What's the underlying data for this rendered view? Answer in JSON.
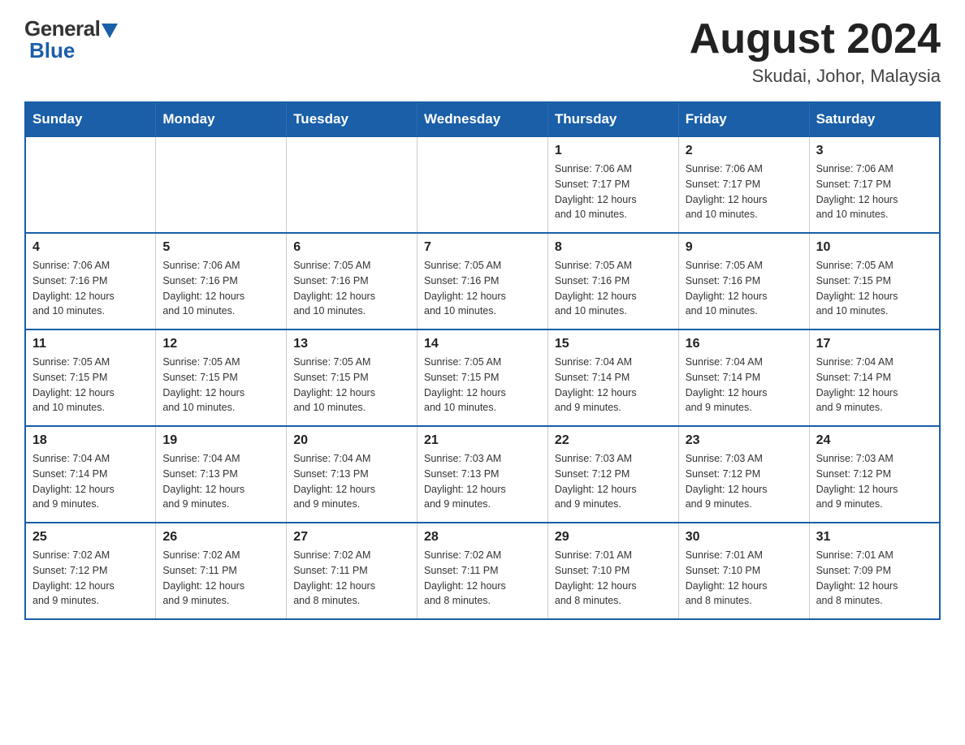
{
  "logo": {
    "general_text": "General",
    "blue_text": "Blue",
    "tagline": "Blue"
  },
  "header": {
    "month_year": "August 2024",
    "location": "Skudai, Johor, Malaysia"
  },
  "days_of_week": [
    "Sunday",
    "Monday",
    "Tuesday",
    "Wednesday",
    "Thursday",
    "Friday",
    "Saturday"
  ],
  "weeks": [
    [
      {
        "day": "",
        "info": ""
      },
      {
        "day": "",
        "info": ""
      },
      {
        "day": "",
        "info": ""
      },
      {
        "day": "",
        "info": ""
      },
      {
        "day": "1",
        "info": "Sunrise: 7:06 AM\nSunset: 7:17 PM\nDaylight: 12 hours\nand 10 minutes."
      },
      {
        "day": "2",
        "info": "Sunrise: 7:06 AM\nSunset: 7:17 PM\nDaylight: 12 hours\nand 10 minutes."
      },
      {
        "day": "3",
        "info": "Sunrise: 7:06 AM\nSunset: 7:17 PM\nDaylight: 12 hours\nand 10 minutes."
      }
    ],
    [
      {
        "day": "4",
        "info": "Sunrise: 7:06 AM\nSunset: 7:16 PM\nDaylight: 12 hours\nand 10 minutes."
      },
      {
        "day": "5",
        "info": "Sunrise: 7:06 AM\nSunset: 7:16 PM\nDaylight: 12 hours\nand 10 minutes."
      },
      {
        "day": "6",
        "info": "Sunrise: 7:05 AM\nSunset: 7:16 PM\nDaylight: 12 hours\nand 10 minutes."
      },
      {
        "day": "7",
        "info": "Sunrise: 7:05 AM\nSunset: 7:16 PM\nDaylight: 12 hours\nand 10 minutes."
      },
      {
        "day": "8",
        "info": "Sunrise: 7:05 AM\nSunset: 7:16 PM\nDaylight: 12 hours\nand 10 minutes."
      },
      {
        "day": "9",
        "info": "Sunrise: 7:05 AM\nSunset: 7:16 PM\nDaylight: 12 hours\nand 10 minutes."
      },
      {
        "day": "10",
        "info": "Sunrise: 7:05 AM\nSunset: 7:15 PM\nDaylight: 12 hours\nand 10 minutes."
      }
    ],
    [
      {
        "day": "11",
        "info": "Sunrise: 7:05 AM\nSunset: 7:15 PM\nDaylight: 12 hours\nand 10 minutes."
      },
      {
        "day": "12",
        "info": "Sunrise: 7:05 AM\nSunset: 7:15 PM\nDaylight: 12 hours\nand 10 minutes."
      },
      {
        "day": "13",
        "info": "Sunrise: 7:05 AM\nSunset: 7:15 PM\nDaylight: 12 hours\nand 10 minutes."
      },
      {
        "day": "14",
        "info": "Sunrise: 7:05 AM\nSunset: 7:15 PM\nDaylight: 12 hours\nand 10 minutes."
      },
      {
        "day": "15",
        "info": "Sunrise: 7:04 AM\nSunset: 7:14 PM\nDaylight: 12 hours\nand 9 minutes."
      },
      {
        "day": "16",
        "info": "Sunrise: 7:04 AM\nSunset: 7:14 PM\nDaylight: 12 hours\nand 9 minutes."
      },
      {
        "day": "17",
        "info": "Sunrise: 7:04 AM\nSunset: 7:14 PM\nDaylight: 12 hours\nand 9 minutes."
      }
    ],
    [
      {
        "day": "18",
        "info": "Sunrise: 7:04 AM\nSunset: 7:14 PM\nDaylight: 12 hours\nand 9 minutes."
      },
      {
        "day": "19",
        "info": "Sunrise: 7:04 AM\nSunset: 7:13 PM\nDaylight: 12 hours\nand 9 minutes."
      },
      {
        "day": "20",
        "info": "Sunrise: 7:04 AM\nSunset: 7:13 PM\nDaylight: 12 hours\nand 9 minutes."
      },
      {
        "day": "21",
        "info": "Sunrise: 7:03 AM\nSunset: 7:13 PM\nDaylight: 12 hours\nand 9 minutes."
      },
      {
        "day": "22",
        "info": "Sunrise: 7:03 AM\nSunset: 7:12 PM\nDaylight: 12 hours\nand 9 minutes."
      },
      {
        "day": "23",
        "info": "Sunrise: 7:03 AM\nSunset: 7:12 PM\nDaylight: 12 hours\nand 9 minutes."
      },
      {
        "day": "24",
        "info": "Sunrise: 7:03 AM\nSunset: 7:12 PM\nDaylight: 12 hours\nand 9 minutes."
      }
    ],
    [
      {
        "day": "25",
        "info": "Sunrise: 7:02 AM\nSunset: 7:12 PM\nDaylight: 12 hours\nand 9 minutes."
      },
      {
        "day": "26",
        "info": "Sunrise: 7:02 AM\nSunset: 7:11 PM\nDaylight: 12 hours\nand 9 minutes."
      },
      {
        "day": "27",
        "info": "Sunrise: 7:02 AM\nSunset: 7:11 PM\nDaylight: 12 hours\nand 8 minutes."
      },
      {
        "day": "28",
        "info": "Sunrise: 7:02 AM\nSunset: 7:11 PM\nDaylight: 12 hours\nand 8 minutes."
      },
      {
        "day": "29",
        "info": "Sunrise: 7:01 AM\nSunset: 7:10 PM\nDaylight: 12 hours\nand 8 minutes."
      },
      {
        "day": "30",
        "info": "Sunrise: 7:01 AM\nSunset: 7:10 PM\nDaylight: 12 hours\nand 8 minutes."
      },
      {
        "day": "31",
        "info": "Sunrise: 7:01 AM\nSunset: 7:09 PM\nDaylight: 12 hours\nand 8 minutes."
      }
    ]
  ]
}
